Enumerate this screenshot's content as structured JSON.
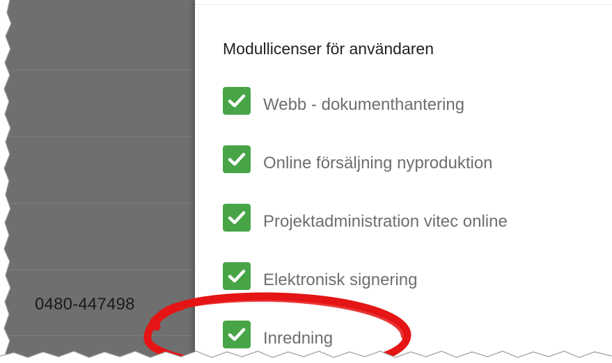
{
  "background": {
    "phone_number": "0480-447498"
  },
  "licenses": {
    "title": "Modullicenser för användaren",
    "modules": [
      {
        "label": "Webb - dokumenthantering",
        "checked": true
      },
      {
        "label": "Online försäljning nyproduktion",
        "checked": true
      },
      {
        "label": "Projektadministration vitec online",
        "checked": true
      },
      {
        "label": "Elektronisk signering",
        "checked": true
      },
      {
        "label": "Inredning",
        "checked": true
      }
    ]
  },
  "colors": {
    "checkbox_checked": "#47a548",
    "annotation": "#e51515",
    "overlay": "#6f6f6f"
  },
  "icons": {
    "checkbox": "checkmark-icon"
  }
}
